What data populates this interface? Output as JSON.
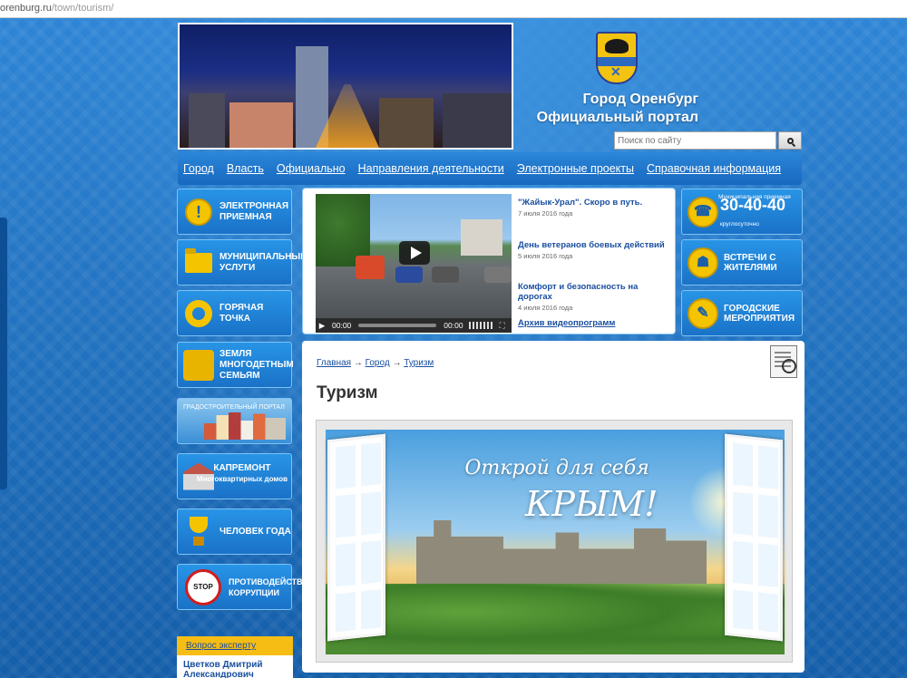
{
  "browser": {
    "url_domain": "orenburg.ru",
    "url_path": "/town/tourism/"
  },
  "header": {
    "title_line1": "Город Оренбург",
    "title_line2": "Официальный портал",
    "search_placeholder": "Поиск по сайту"
  },
  "nav": {
    "items": [
      {
        "label": "Город"
      },
      {
        "label": "Власть"
      },
      {
        "label": "Официально"
      },
      {
        "label": "Направления деятельности"
      },
      {
        "label": "Электронные проекты"
      },
      {
        "label": "Справочная информация"
      }
    ]
  },
  "left_sidebar": {
    "items": [
      {
        "label": "Электронная приемная",
        "icon": "exclamation-icon"
      },
      {
        "label": "Муниципальные услуги",
        "icon": "folder-icon"
      },
      {
        "label": "Горячая точка",
        "icon": "ring-icon"
      },
      {
        "label": "Земля многодетным семьям",
        "icon": "family-icon"
      },
      {
        "label": "Градостроительный портал",
        "icon": "city-icon"
      },
      {
        "label": "Капремонт",
        "sub": "Многоквартирных домов",
        "icon": "house-icon"
      },
      {
        "label": "Человек года",
        "icon": "trophy-icon"
      },
      {
        "label": "Противодействие коррупции",
        "icon": "stop-sign-icon",
        "stop_text": "STOP",
        "stop_sub": "КОРРУПЦИИ"
      }
    ]
  },
  "video": {
    "time_current": "00:00",
    "time_total": "00:00",
    "news": [
      {
        "title": "\"Жайык-Урал\". Скоро в путь.",
        "date": "7 июля 2016 года"
      },
      {
        "title": "День ветеранов боевых действий",
        "date": "5 июля 2016 года"
      },
      {
        "title": "Комфорт и безопасность на дорогах",
        "date": "4 июля 2016 года"
      }
    ],
    "archive_link": "Архив видеопрограмм"
  },
  "right_sidebar": {
    "phone": {
      "caption": "Муниципальная приемная",
      "number": "30-40-40",
      "note": "круглосуточно"
    },
    "items": [
      {
        "label": "Встречи с жителями",
        "icon": "people-icon"
      },
      {
        "label": "Городские мероприятия",
        "icon": "event-icon"
      }
    ]
  },
  "content": {
    "breadcrumb": [
      {
        "label": "Главная"
      },
      {
        "label": "Город"
      },
      {
        "label": "Туризм"
      }
    ],
    "breadcrumb_separator": "→",
    "page_title": "Туризм",
    "banner": {
      "line1": "Открой для себя",
      "line2": "КРЫМ!"
    }
  },
  "expert": {
    "header": "Вопрос эксперту",
    "name_line1": "Цветков Дмитрий",
    "name_line2": "Александрович"
  },
  "colors": {
    "page_blue": "#1a6fc0",
    "accent_yellow": "#f5c400",
    "link_blue": "#1a4fa0"
  }
}
